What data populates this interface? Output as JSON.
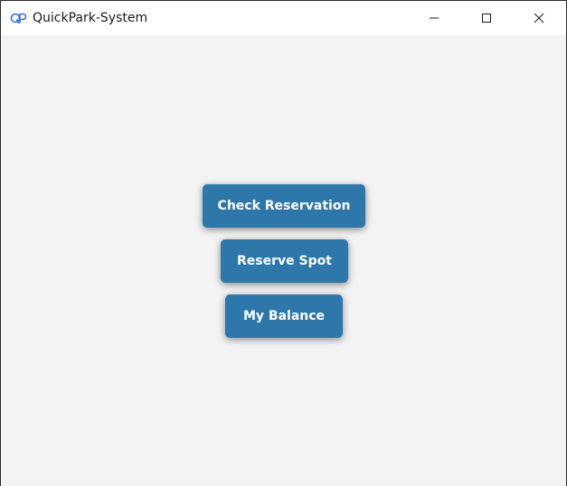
{
  "window": {
    "title": "QuickPark-System",
    "icon": "quickpark-logo-icon",
    "controls": {
      "minimize": "minimize-icon",
      "maximize": "maximize-icon",
      "close": "close-icon"
    }
  },
  "menu": {
    "check_reservation": "Check Reservation",
    "reserve_spot": "Reserve Spot",
    "my_balance": "My Balance"
  },
  "colors": {
    "button_bg": "#2e77aa",
    "button_text": "#ffffff",
    "content_bg": "#f3f3f3",
    "titlebar_bg": "#ffffff",
    "logo_accent": "#3a6fd8"
  }
}
